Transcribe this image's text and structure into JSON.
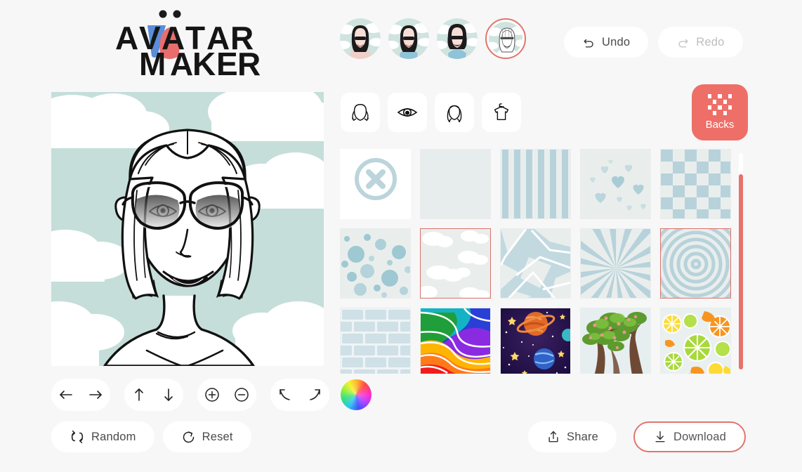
{
  "app": {
    "logo_line1": "AVATAR",
    "logo_line2": "MAKER",
    "page_bg": "#f7f7f7",
    "accent": "#ee6f68"
  },
  "header": {
    "avatars": [
      {
        "name": "avatar-thumb-1",
        "selected": false,
        "hair": "#1b1b1b",
        "skin": "#f6ded7",
        "top": "#f0cfc8"
      },
      {
        "name": "avatar-thumb-2",
        "selected": false,
        "hair": "#1b1b1b",
        "skin": "#f6ded7",
        "top": "#8fc3d8"
      },
      {
        "name": "avatar-thumb-3",
        "selected": false,
        "hair": "#1b1b1b",
        "skin": "#f6ded7",
        "top": "#8fc3d8"
      },
      {
        "name": "avatar-thumb-4",
        "selected": true,
        "hair": "#bdbdbd",
        "skin": "#ffffff",
        "top": "#ffffff"
      }
    ],
    "undo_label": "Undo",
    "redo_label": "Redo",
    "undo_enabled": true,
    "redo_enabled": false
  },
  "preview": {
    "background_name": "clouds",
    "background_color": "#c5ded9",
    "cloud_color": "#ffffff",
    "style": "line-art",
    "description": "Black and white line-art avatar of a smiling woman with a shoulder-length bob, cat-eye sunglasses with gradient lenses, on a mint background with white clouds"
  },
  "transform_controls": [
    {
      "name": "move-left-button",
      "icon": "arrow-left-icon"
    },
    {
      "name": "move-right-button",
      "icon": "arrow-right-icon"
    },
    {
      "name": "move-up-button",
      "icon": "arrow-up-icon"
    },
    {
      "name": "move-down-button",
      "icon": "arrow-down-icon"
    },
    {
      "name": "zoom-in-button",
      "icon": "plus-circle-icon"
    },
    {
      "name": "zoom-out-button",
      "icon": "minus-circle-icon"
    },
    {
      "name": "rotate-left-button",
      "icon": "arrow-up-left-icon"
    },
    {
      "name": "rotate-right-button",
      "icon": "arrow-up-right-icon"
    }
  ],
  "actions": {
    "random_label": "Random",
    "reset_label": "Reset",
    "share_label": "Share",
    "download_label": "Download"
  },
  "categories": [
    {
      "name": "tab-face",
      "icon": "face-shape-icon",
      "label": "Face",
      "selected": false
    },
    {
      "name": "tab-eyes",
      "icon": "eye-icon",
      "label": "Eyes",
      "selected": false
    },
    {
      "name": "tab-hair",
      "icon": "hair-icon",
      "label": "Hair",
      "selected": false
    },
    {
      "name": "tab-clothes",
      "icon": "t-shirt-icon",
      "label": "Clothes",
      "selected": false
    }
  ],
  "backs_button": {
    "label": "Backs",
    "icon": "checkerboard-icon",
    "active": true,
    "color": "#ee6f68"
  },
  "backgrounds": {
    "rows": 3,
    "columns": 5,
    "items": [
      {
        "name": "swatch-none",
        "pattern": "none",
        "selected": false
      },
      {
        "name": "swatch-plain",
        "pattern": "plain",
        "selected": false
      },
      {
        "name": "swatch-stripes",
        "pattern": "stripes",
        "selected": false
      },
      {
        "name": "swatch-hearts",
        "pattern": "hearts",
        "selected": false
      },
      {
        "name": "swatch-checks",
        "pattern": "checks",
        "selected": false
      },
      {
        "name": "swatch-dots",
        "pattern": "dots",
        "selected": false
      },
      {
        "name": "swatch-clouds",
        "pattern": "clouds",
        "selected": true
      },
      {
        "name": "swatch-shards",
        "pattern": "shards",
        "selected": false
      },
      {
        "name": "swatch-rays",
        "pattern": "rays",
        "selected": false
      },
      {
        "name": "swatch-rings",
        "pattern": "rings",
        "selected": true
      },
      {
        "name": "swatch-bricks",
        "pattern": "bricks",
        "selected": false
      },
      {
        "name": "swatch-rainbow",
        "pattern": "rainbow",
        "selected": false
      },
      {
        "name": "swatch-space",
        "pattern": "space",
        "selected": false
      },
      {
        "name": "swatch-tree",
        "pattern": "tree",
        "selected": false
      },
      {
        "name": "swatch-citrus",
        "pattern": "citrus",
        "selected": false
      }
    ],
    "palette": {
      "tile_bg": "#e9eeed",
      "pattern_blue": "#b7d2da",
      "selected_border": "#d9736c"
    }
  },
  "color_picker": {
    "name": "color-wheel",
    "type": "hue-wheel"
  },
  "scrollbar": {
    "name": "backgrounds-scrollbar",
    "color": "#e7736a"
  }
}
